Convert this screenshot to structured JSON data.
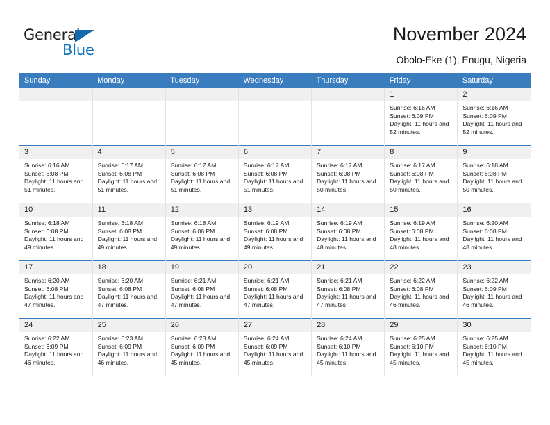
{
  "brand": {
    "name_part1": "General",
    "name_part2": "Blue",
    "triangle_icon": "triangle-icon",
    "accent_color": "#1175c0"
  },
  "header": {
    "title": "November 2024",
    "location": "Obolo-Eke (1), Enugu, Nigeria"
  },
  "colors": {
    "header_row": "#3a7dbf",
    "day_number_bg": "#f0f0f0",
    "text": "#1a1a1a"
  },
  "weekday_headers": [
    "Sunday",
    "Monday",
    "Tuesday",
    "Wednesday",
    "Thursday",
    "Friday",
    "Saturday"
  ],
  "labels": {
    "sunrise_prefix": "Sunrise: ",
    "sunset_prefix": "Sunset: ",
    "daylight_prefix": "Daylight: "
  },
  "weeks": [
    [
      {
        "day": "",
        "empty": true
      },
      {
        "day": "",
        "empty": true
      },
      {
        "day": "",
        "empty": true
      },
      {
        "day": "",
        "empty": true
      },
      {
        "day": "",
        "empty": true
      },
      {
        "day": "1",
        "sunrise": "Sunrise: 6:16 AM",
        "sunset": "Sunset: 6:09 PM",
        "daylight": "Daylight: 11 hours and 52 minutes."
      },
      {
        "day": "2",
        "sunrise": "Sunrise: 6:16 AM",
        "sunset": "Sunset: 6:09 PM",
        "daylight": "Daylight: 11 hours and 52 minutes."
      }
    ],
    [
      {
        "day": "3",
        "sunrise": "Sunrise: 6:16 AM",
        "sunset": "Sunset: 6:08 PM",
        "daylight": "Daylight: 11 hours and 51 minutes."
      },
      {
        "day": "4",
        "sunrise": "Sunrise: 6:17 AM",
        "sunset": "Sunset: 6:08 PM",
        "daylight": "Daylight: 11 hours and 51 minutes."
      },
      {
        "day": "5",
        "sunrise": "Sunrise: 6:17 AM",
        "sunset": "Sunset: 6:08 PM",
        "daylight": "Daylight: 11 hours and 51 minutes."
      },
      {
        "day": "6",
        "sunrise": "Sunrise: 6:17 AM",
        "sunset": "Sunset: 6:08 PM",
        "daylight": "Daylight: 11 hours and 51 minutes."
      },
      {
        "day": "7",
        "sunrise": "Sunrise: 6:17 AM",
        "sunset": "Sunset: 6:08 PM",
        "daylight": "Daylight: 11 hours and 50 minutes."
      },
      {
        "day": "8",
        "sunrise": "Sunrise: 6:17 AM",
        "sunset": "Sunset: 6:08 PM",
        "daylight": "Daylight: 11 hours and 50 minutes."
      },
      {
        "day": "9",
        "sunrise": "Sunrise: 6:18 AM",
        "sunset": "Sunset: 6:08 PM",
        "daylight": "Daylight: 11 hours and 50 minutes."
      }
    ],
    [
      {
        "day": "10",
        "sunrise": "Sunrise: 6:18 AM",
        "sunset": "Sunset: 6:08 PM",
        "daylight": "Daylight: 11 hours and 49 minutes."
      },
      {
        "day": "11",
        "sunrise": "Sunrise: 6:18 AM",
        "sunset": "Sunset: 6:08 PM",
        "daylight": "Daylight: 11 hours and 49 minutes."
      },
      {
        "day": "12",
        "sunrise": "Sunrise: 6:18 AM",
        "sunset": "Sunset: 6:08 PM",
        "daylight": "Daylight: 11 hours and 49 minutes."
      },
      {
        "day": "13",
        "sunrise": "Sunrise: 6:19 AM",
        "sunset": "Sunset: 6:08 PM",
        "daylight": "Daylight: 11 hours and 49 minutes."
      },
      {
        "day": "14",
        "sunrise": "Sunrise: 6:19 AM",
        "sunset": "Sunset: 6:08 PM",
        "daylight": "Daylight: 11 hours and 48 minutes."
      },
      {
        "day": "15",
        "sunrise": "Sunrise: 6:19 AM",
        "sunset": "Sunset: 6:08 PM",
        "daylight": "Daylight: 11 hours and 48 minutes."
      },
      {
        "day": "16",
        "sunrise": "Sunrise: 6:20 AM",
        "sunset": "Sunset: 6:08 PM",
        "daylight": "Daylight: 11 hours and 48 minutes."
      }
    ],
    [
      {
        "day": "17",
        "sunrise": "Sunrise: 6:20 AM",
        "sunset": "Sunset: 6:08 PM",
        "daylight": "Daylight: 11 hours and 47 minutes."
      },
      {
        "day": "18",
        "sunrise": "Sunrise: 6:20 AM",
        "sunset": "Sunset: 6:08 PM",
        "daylight": "Daylight: 11 hours and 47 minutes."
      },
      {
        "day": "19",
        "sunrise": "Sunrise: 6:21 AM",
        "sunset": "Sunset: 6:08 PM",
        "daylight": "Daylight: 11 hours and 47 minutes."
      },
      {
        "day": "20",
        "sunrise": "Sunrise: 6:21 AM",
        "sunset": "Sunset: 6:08 PM",
        "daylight": "Daylight: 11 hours and 47 minutes."
      },
      {
        "day": "21",
        "sunrise": "Sunrise: 6:21 AM",
        "sunset": "Sunset: 6:08 PM",
        "daylight": "Daylight: 11 hours and 47 minutes."
      },
      {
        "day": "22",
        "sunrise": "Sunrise: 6:22 AM",
        "sunset": "Sunset: 6:08 PM",
        "daylight": "Daylight: 11 hours and 46 minutes."
      },
      {
        "day": "23",
        "sunrise": "Sunrise: 6:22 AM",
        "sunset": "Sunset: 6:09 PM",
        "daylight": "Daylight: 11 hours and 46 minutes."
      }
    ],
    [
      {
        "day": "24",
        "sunrise": "Sunrise: 6:22 AM",
        "sunset": "Sunset: 6:09 PM",
        "daylight": "Daylight: 11 hours and 46 minutes."
      },
      {
        "day": "25",
        "sunrise": "Sunrise: 6:23 AM",
        "sunset": "Sunset: 6:09 PM",
        "daylight": "Daylight: 11 hours and 46 minutes."
      },
      {
        "day": "26",
        "sunrise": "Sunrise: 6:23 AM",
        "sunset": "Sunset: 6:09 PM",
        "daylight": "Daylight: 11 hours and 45 minutes."
      },
      {
        "day": "27",
        "sunrise": "Sunrise: 6:24 AM",
        "sunset": "Sunset: 6:09 PM",
        "daylight": "Daylight: 11 hours and 45 minutes."
      },
      {
        "day": "28",
        "sunrise": "Sunrise: 6:24 AM",
        "sunset": "Sunset: 6:10 PM",
        "daylight": "Daylight: 11 hours and 45 minutes."
      },
      {
        "day": "29",
        "sunrise": "Sunrise: 6:25 AM",
        "sunset": "Sunset: 6:10 PM",
        "daylight": "Daylight: 11 hours and 45 minutes."
      },
      {
        "day": "30",
        "sunrise": "Sunrise: 6:25 AM",
        "sunset": "Sunset: 6:10 PM",
        "daylight": "Daylight: 11 hours and 45 minutes."
      }
    ]
  ]
}
